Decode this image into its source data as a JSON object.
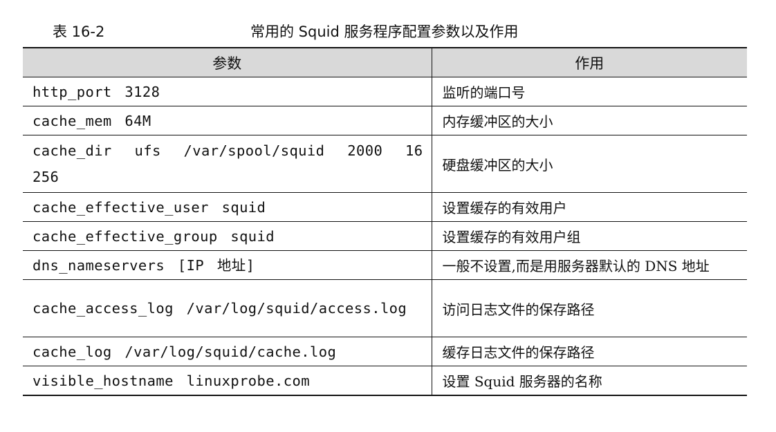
{
  "caption": {
    "number": "表 16-2",
    "title": "常用的 Squid 服务程序配置参数以及作用"
  },
  "table": {
    "headers": [
      "参数",
      "作用"
    ],
    "rows": [
      {
        "param": "http_port 3128",
        "desc": "监听的端口号"
      },
      {
        "param": "cache_mem 64M",
        "desc": "内存缓冲区的大小"
      },
      {
        "param": "cache_dir ufs /var/spool/squid 2000 16 256",
        "desc": "硬盘缓冲区的大小"
      },
      {
        "param": "cache_effective_user squid",
        "desc": "设置缓存的有效用户"
      },
      {
        "param": "cache_effective_group squid",
        "desc": "设置缓存的有效用户组"
      },
      {
        "param": "dns_nameservers [IP 地址]",
        "desc": "一般不设置,而是用服务器默认的 DNS 地址"
      },
      {
        "param": "cache_access_log /var/log/squid/access.log",
        "desc": "访问日志文件的保存路径"
      },
      {
        "param": "cache_log /var/log/squid/cache.log",
        "desc": "缓存日志文件的保存路径"
      },
      {
        "param": "visible_hostname linuxprobe.com",
        "desc": "设置 Squid 服务器的名称"
      }
    ]
  }
}
